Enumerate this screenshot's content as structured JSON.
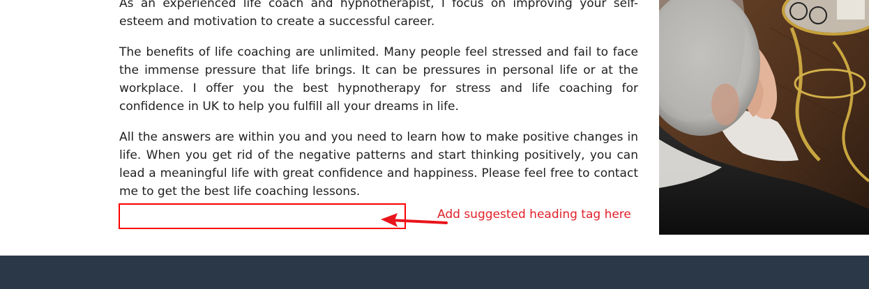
{
  "article": {
    "paragraphs": [
      "As an experienced life coach and hypnotherapist, I focus on improving your self-esteem and motivation to create a successful career.",
      "The benefits of life coaching are unlimited. Many people feel stressed and fail to face the immense pressure that life brings. It can be pressures in personal life or at the workplace. I offer you the best hypnotherapy for stress and life coaching for confidence in UK to help you fulfill all your dreams in life.",
      "All the answers are within you and you need to learn how to make positive changes in life. When you get rid of the negative patterns and start thinking positively, you can lead a meaningful life with great confidence and happiness. Please feel free to contact me to get the best life coaching lessons."
    ]
  },
  "annotation": {
    "label": "Add suggested heading tag here",
    "color": "#ff0000"
  },
  "footer": {
    "color": "#2b3847"
  }
}
